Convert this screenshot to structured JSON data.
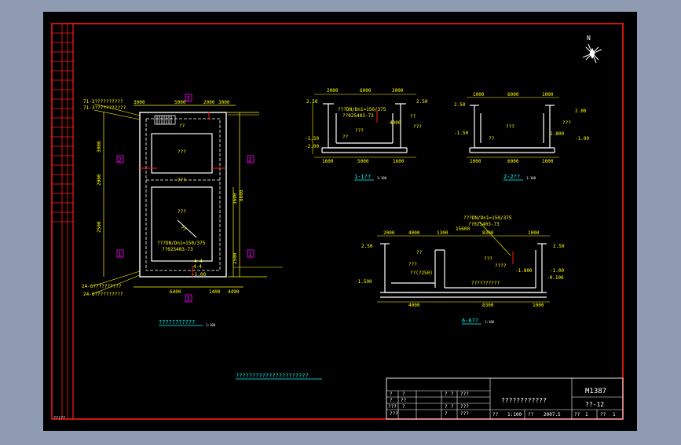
{
  "colors": {
    "window_bg": "#8e9bb1",
    "canvas_bg": "#000000",
    "frame": "#ff1a1a",
    "cyan": "#00ffff",
    "yellow": "#ffff00",
    "white": "#ffffff",
    "green": "#00ff66",
    "magenta": "#ff00ff"
  },
  "plan": {
    "title": "???????????",
    "scale": "1:100",
    "section_marks": [
      "1",
      "2",
      "3",
      "1",
      "2",
      "3"
    ],
    "top_dims": [
      "3000",
      "5000",
      "2000",
      "3000"
    ],
    "bottom_dims": [
      "6400",
      "1400",
      "4490"
    ],
    "left_dims": [
      "3000",
      "2000",
      "2500"
    ],
    "right_dims": [
      "8600",
      "3600",
      "2500"
    ],
    "room_labels": [
      "??",
      "???",
      "???",
      "???"
    ],
    "pipe_note_1": "???DN/Dn1=150/375",
    "pipe_note_2": "??025403-73",
    "side_notes": [
      "71-3??????????",
      "71-3???????????",
      "24-6??????????",
      "24-6??????????"
    ],
    "stair_label": "4-4",
    "ramp_label": "??",
    "levels": [
      "4-4",
      "-1.00"
    ]
  },
  "section_1": {
    "title": "1-1??",
    "scale": "1:100",
    "dims_top": [
      "2000",
      "6000",
      "2000"
    ],
    "dims_bottom": [
      "1600",
      "5000",
      "1600"
    ],
    "levels": [
      "2.50",
      "2.50",
      "-1.50",
      "-2.00",
      "4000"
    ],
    "pipe_note_1": "???DN/Dn1=150/375",
    "pipe_note_2": "??025403-73",
    "labels": [
      "???",
      "???",
      "??",
      "??"
    ]
  },
  "section_2": {
    "title": "2-2??",
    "scale": "1:100",
    "dims_top": [
      "1000",
      "6000",
      "1000"
    ],
    "dims_bottom": [
      "1000",
      "6000",
      "1000"
    ],
    "levels": [
      "2.50",
      "2.00",
      "1.800",
      "-1.50",
      "-1.00"
    ],
    "labels": [
      "???",
      "???",
      "??"
    ]
  },
  "section_3": {
    "title": "6-6??",
    "scale": "1:100",
    "dims_top": [
      "2000",
      "4000",
      "1300",
      "15600",
      "8300",
      "1000"
    ],
    "dims_bottom": [
      "4000",
      "8300",
      "1000"
    ],
    "levels": [
      "2.50",
      "2.50",
      "-1.500",
      "-1.800",
      "-1.00",
      "-0.100"
    ],
    "pipe_note_1": "???DN/Dn1=150/375",
    "pipe_note_2": "??025403-73",
    "labels": [
      "???",
      "???",
      "??",
      "??(?250)",
      "????",
      "??????????"
    ]
  },
  "footer_note": "??????????????????????",
  "corner_note": "??(??",
  "title_block": {
    "drawing_name": "????????????",
    "code": "M1387",
    "sheet_no": "??-12",
    "scale_label": "??",
    "scale_value": "1:100",
    "date_label": "??",
    "date_value": "2007.5",
    "sheet_label": "??",
    "sheet_value": "1",
    "total_label": "??",
    "total_value": "1",
    "rows": [
      [
        "?",
        "?",
        "?",
        "?",
        "???"
      ],
      [
        "?",
        "??",
        "",
        "",
        ""
      ],
      [
        "???",
        "?",
        "?",
        "?",
        "???"
      ]
    ]
  }
}
